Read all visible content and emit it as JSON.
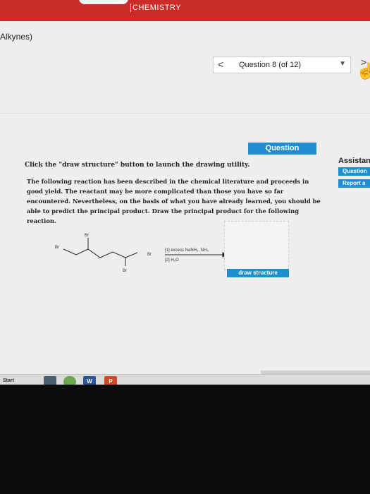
{
  "header": {
    "subject": "CHEMISTRY"
  },
  "breadcrumb": "Alkynes)",
  "question_nav": {
    "prev": "<",
    "label": "Question 8 (of 12)",
    "dropdown": "▼",
    "next": ">"
  },
  "tab": {
    "label": "Question"
  },
  "assistance": {
    "title": "Assistance",
    "buttons": [
      "Question",
      "Report a"
    ]
  },
  "instruction": "Click the \"draw structure\" button to launch the drawing utility.",
  "body": "The following reaction has been described in the chemical literature and proceeds in good yield. The reactant may be more complicated than those you have so far encountered. Nevertheless, on the basis of what you have already learned, you should be able to predict the principal product. Draw the principal product for the following reaction.",
  "reaction": {
    "atoms": [
      "Br",
      "Br",
      "Br",
      "Br"
    ],
    "step1": "[1] excess NaNH₂, NH₃",
    "step2": "[2] H₂O"
  },
  "draw_button": "draw structure",
  "taskbar": {
    "start": "Start",
    "apps": [
      "W",
      "P"
    ]
  },
  "colors": {
    "accent": "#1f8ed0",
    "brand": "#cb2b26"
  }
}
